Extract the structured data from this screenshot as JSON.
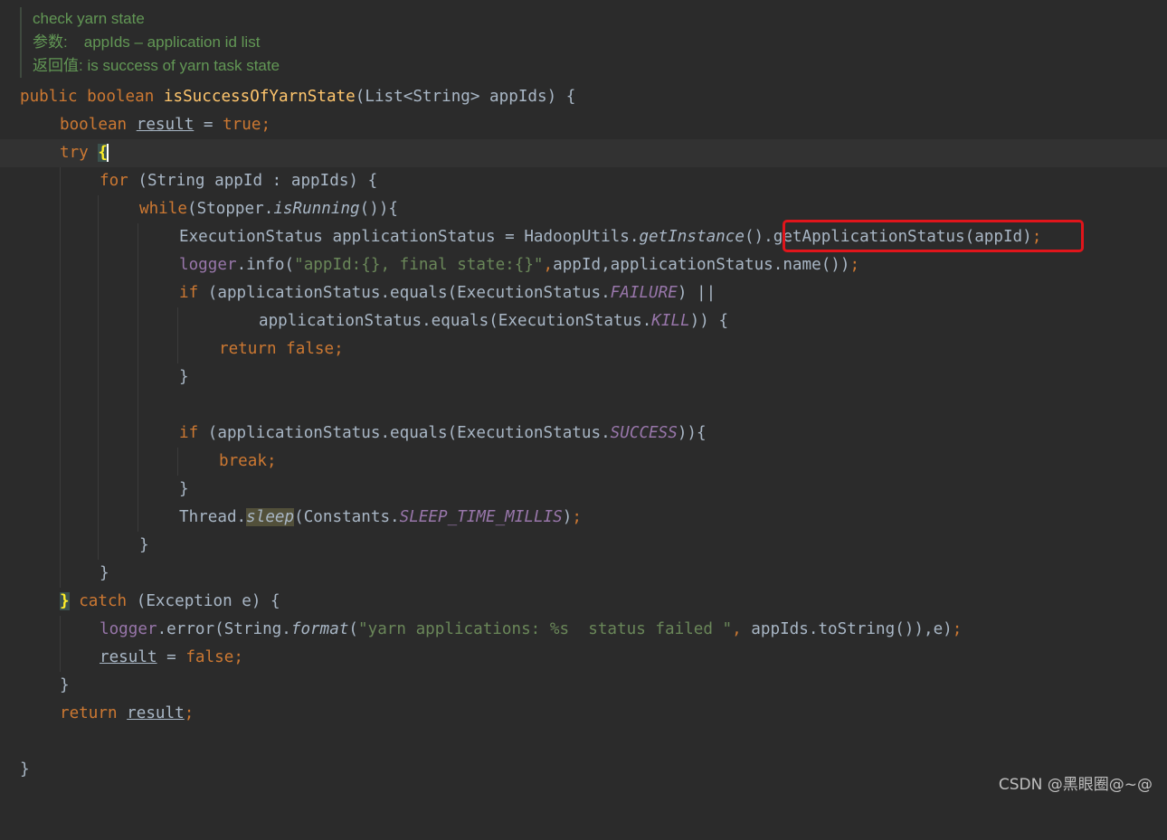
{
  "doc": {
    "line1": "check yarn state",
    "param_label": "参数:",
    "param_text": "appIds – application id list",
    "return_label": "返回值:",
    "return_text": "is success of yarn task state"
  },
  "code": {
    "public": "public",
    "boolean": "boolean",
    "method_name": "isSuccessOfYarnState",
    "signature_rest": "(List<String> appIds) {",
    "result_var": "result",
    "eq": " = ",
    "true": "true",
    "semi": ";",
    "try": "try",
    "open_brace": "{",
    "for": "for",
    "for_rest": " (String appId : appIds) {",
    "while": "while",
    "while_paren": "(",
    "stopper": "Stopper.",
    "is_running": "isRunning",
    "while_rest": "()){",
    "exec_decl": "ExecutionStatus applicationStatus = HadoopUtils.",
    "get_instance": "getInstance",
    "get_instance_paren": "()",
    "get_app_status": ".getApplicationStatus(appId)",
    "logger": "logger",
    "info_call": ".info(",
    "info_str": "\"appId:{}, final state:{}\"",
    "comma": ",",
    "info_rest": "appId,applicationStatus.name())",
    "if": "if",
    "if1_mid": " (applicationStatus.equals(ExecutionStatus.",
    "failure": "FAILURE",
    "if1_end": ") ||",
    "cont_start": "applicationStatus.equals(ExecutionStatus.",
    "kill": "KILL",
    "cont_end": ")) {",
    "return": "return",
    "false": "false",
    "close_brace": "}",
    "success": "SUCCESS",
    "if2_end": ")){",
    "break": "break",
    "thread": "Thread.",
    "sleep": "sleep",
    "constants": "(Constants.",
    "sleep_const": "SLEEP_TIME_MILLIS",
    "close_paren": ")",
    "catch": "catch",
    "catch_rest": " (Exception e) {",
    "error_call": ".error(String.",
    "format": "format",
    "format_paren": "(",
    "error_str": "\"yarn applications: %s  status failed \"",
    "error_rest": " appIds.toString()),e)"
  },
  "watermark": "CSDN @黑眼圈@~@",
  "colors": {
    "background": "#2b2b2b",
    "keyword": "#cc7832",
    "method": "#ffc66d",
    "string": "#6a8759",
    "constant": "#9876aa",
    "doc_comment": "#629755",
    "highlight_box": "#e0151b"
  }
}
